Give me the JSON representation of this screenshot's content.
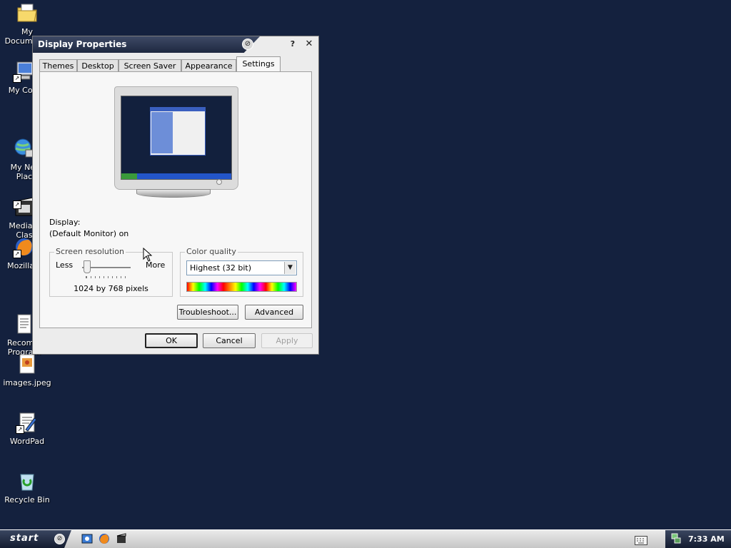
{
  "desktop": {
    "icons": [
      {
        "label": "My Documents"
      },
      {
        "label": "My Com"
      },
      {
        "label": "My Net\nPlac"
      },
      {
        "label": "Media P\nClas"
      },
      {
        "label": "Mozilla F"
      },
      {
        "label": "Recomm\nProgram"
      },
      {
        "label": "images.jpeg"
      },
      {
        "label": "WordPad"
      },
      {
        "label": "Recycle Bin"
      }
    ]
  },
  "window": {
    "title": "Display Properties",
    "help_label": "?",
    "close_label": "✕",
    "tabs": [
      {
        "label": "Themes"
      },
      {
        "label": "Desktop"
      },
      {
        "label": "Screen Saver"
      },
      {
        "label": "Appearance"
      },
      {
        "label": "Settings"
      }
    ],
    "active_tab": "Settings",
    "display_label": "Display:",
    "display_value": "(Default Monitor) on",
    "resolution": {
      "legend": "Screen resolution",
      "less_label": "Less",
      "more_label": "More",
      "value_text": "1024 by 768 pixels"
    },
    "color_quality": {
      "legend": "Color quality",
      "selected": "Highest (32 bit)"
    },
    "buttons": {
      "troubleshoot": "Troubleshoot...",
      "advanced": "Advanced",
      "ok": "OK",
      "cancel": "Cancel",
      "apply": "Apply"
    }
  },
  "taskbar": {
    "start_label": "start",
    "clock": "7:33 AM"
  },
  "colors": {
    "desktop_bg": "#14213e",
    "titlebar_dark": "#1e2840",
    "window_bg": "#ececec"
  }
}
